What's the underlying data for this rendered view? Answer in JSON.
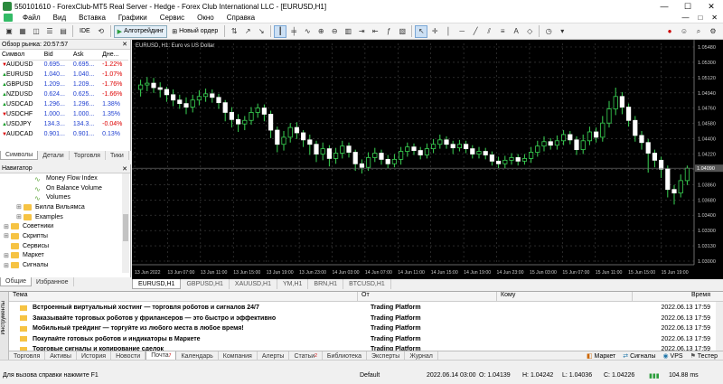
{
  "window": {
    "title": "550101610 - ForexClub-MT5 Real Server - Hedge - Forex Club International LLC - [EURUSD,H1]"
  },
  "menu": {
    "items": [
      "Файл",
      "Вид",
      "Вставка",
      "Графики",
      "Сервис",
      "Окно",
      "Справка"
    ],
    "right": [
      "—",
      "□",
      "✕"
    ]
  },
  "toolbar": {
    "algo": "Алготрейдинг",
    "neworder": "Новый ордер",
    "ide": "IDE"
  },
  "market_watch": {
    "header": "Обзор рынка: 20:57:57",
    "columns": [
      "Символ",
      "Bid",
      "Ask",
      "Дне..."
    ],
    "rows": [
      {
        "sym": "AUDUSD",
        "bid": "0.695...",
        "ask": "0.695...",
        "chg": "-1.22%",
        "dir": "dn"
      },
      {
        "sym": "EURUSD",
        "bid": "1.040...",
        "ask": "1.040...",
        "chg": "-1.07%",
        "dir": "up"
      },
      {
        "sym": "GBPUSD",
        "bid": "1.209...",
        "ask": "1.209...",
        "chg": "-1.76%",
        "dir": "up"
      },
      {
        "sym": "NZDUSD",
        "bid": "0.624...",
        "ask": "0.625...",
        "chg": "-1.66%",
        "dir": "up"
      },
      {
        "sym": "USDCAD",
        "bid": "1.296...",
        "ask": "1.296...",
        "chg": "1.38%",
        "dir": "up"
      },
      {
        "sym": "USDCHF",
        "bid": "1.000...",
        "ask": "1.000...",
        "chg": "1.35%",
        "dir": "dn"
      },
      {
        "sym": "USDJPY",
        "bid": "134.3...",
        "ask": "134.3...",
        "chg": "-0.04%",
        "dir": "up"
      },
      {
        "sym": "AUDCAD",
        "bid": "0.901...",
        "ask": "0.901...",
        "chg": "0.13%",
        "dir": "dn"
      }
    ],
    "tabs": [
      "Символы",
      "Детали",
      "Торговля",
      "Тики"
    ]
  },
  "navigator": {
    "header": "Навигатор",
    "items": [
      {
        "label": "Money Flow Index",
        "kind": "ind",
        "indent": 38
      },
      {
        "label": "On Balance Volume",
        "kind": "ind",
        "indent": 38
      },
      {
        "label": "Volumes",
        "kind": "ind",
        "indent": 38
      },
      {
        "label": "Билла Вильямса",
        "kind": "fold",
        "indent": 18,
        "pm": "⊞"
      },
      {
        "label": "Examples",
        "kind": "fold",
        "indent": 18,
        "pm": "⊞"
      },
      {
        "label": "Советники",
        "kind": "fold",
        "indent": 4,
        "pm": "⊞"
      },
      {
        "label": "Скрипты",
        "kind": "fold",
        "indent": 4,
        "pm": "⊞"
      },
      {
        "label": "Сервисы",
        "kind": "fold",
        "indent": 4,
        "pm": ""
      },
      {
        "label": "Маркет",
        "kind": "fold",
        "indent": 4,
        "pm": "⊞"
      },
      {
        "label": "Сигналы",
        "kind": "fold",
        "indent": 4,
        "pm": "⊞"
      }
    ],
    "tabs": [
      "Общие",
      "Избранное"
    ]
  },
  "chart": {
    "label": "EURUSD, H1:  Euro vs US Dollar",
    "tabs": [
      "EURUSD,H1",
      "GBPUSD,H1",
      "XAUUSD,H1",
      "YM,H1",
      "BRN,H1",
      "BTCUSD,H1"
    ]
  },
  "chart_data": {
    "type": "candlestick",
    "ylim": [
      1.03,
      1.055
    ],
    "y_ticks": [
      "1.05480",
      "1.05300",
      "1.05120",
      "1.04940",
      "1.04760",
      "1.04580",
      "1.04400",
      "1.04220",
      "1.04040",
      "1.03860",
      "1.03680",
      "1.03400",
      "1.03300",
      "1.03130",
      "1.03000"
    ],
    "x_ticks": [
      "13 Jun 2022",
      "13 Jun 07:00",
      "13 Jun 11:00",
      "13 Jun 15:00",
      "13 Jun 19:00",
      "13 Jun 23:00",
      "14 Jun 03:00",
      "14 Jun 07:00",
      "14 Jun 11:00",
      "14 Jun 15:00",
      "14 Jun 19:00",
      "14 Jun 23:00",
      "15 Jun 03:00",
      "15 Jun 07:00",
      "15 Jun 11:00",
      "15 Jun 15:00",
      "15 Jun 19:00"
    ],
    "current_price": "1.04090",
    "candles": [
      [
        1.0498,
        1.0503,
        1.049,
        1.0509
      ],
      [
        1.0503,
        1.0505,
        1.0496,
        1.0512
      ],
      [
        1.0505,
        1.05,
        1.0494,
        1.0511
      ],
      [
        1.05,
        1.0498,
        1.0489,
        1.0506
      ],
      [
        1.0498,
        1.0492,
        1.0484,
        1.0501
      ],
      [
        1.0492,
        1.0486,
        1.0479,
        1.0498
      ],
      [
        1.0486,
        1.0482,
        1.0476,
        1.0492
      ],
      [
        1.0482,
        1.0478,
        1.047,
        1.0489
      ],
      [
        1.0478,
        1.0486,
        1.0472,
        1.0492
      ],
      [
        1.0486,
        1.049,
        1.048,
        1.0497
      ],
      [
        1.049,
        1.0493,
        1.0484,
        1.0499
      ],
      [
        1.0493,
        1.0489,
        1.0483,
        1.0498
      ],
      [
        1.0489,
        1.0483,
        1.0476,
        1.0493
      ],
      [
        1.0483,
        1.0472,
        1.0462,
        1.0486
      ],
      [
        1.0472,
        1.0464,
        1.0455,
        1.0478
      ],
      [
        1.0464,
        1.0459,
        1.045,
        1.047
      ],
      [
        1.0459,
        1.0463,
        1.0452,
        1.0468
      ],
      [
        1.0463,
        1.0472,
        1.0458,
        1.0478
      ],
      [
        1.0472,
        1.0477,
        1.0466,
        1.0482
      ],
      [
        1.0477,
        1.047,
        1.0462,
        1.0481
      ],
      [
        1.047,
        1.0452,
        1.0443,
        1.0474
      ],
      [
        1.0452,
        1.0436,
        1.0427,
        1.0456
      ],
      [
        1.0436,
        1.0444,
        1.0429,
        1.0451
      ],
      [
        1.0444,
        1.0455,
        1.0438,
        1.046
      ],
      [
        1.0455,
        1.0449,
        1.0442,
        1.0461
      ],
      [
        1.0449,
        1.0441,
        1.0433,
        1.0452
      ],
      [
        1.0441,
        1.0436,
        1.0424,
        1.0447
      ],
      [
        1.0436,
        1.0425,
        1.0416,
        1.044
      ],
      [
        1.0425,
        1.0431,
        1.0418,
        1.0438
      ],
      [
        1.0431,
        1.042,
        1.0411,
        1.0435
      ],
      [
        1.042,
        1.0426,
        1.0414,
        1.0432
      ],
      [
        1.0426,
        1.0434,
        1.042,
        1.044
      ],
      [
        1.0434,
        1.0427,
        1.0421,
        1.0438
      ],
      [
        1.0427,
        1.0414,
        1.0406,
        1.043
      ],
      [
        1.0414,
        1.041,
        1.0403,
        1.0419
      ],
      [
        1.041,
        1.0421,
        1.0406,
        1.0427
      ],
      [
        1.0421,
        1.0426,
        1.0416,
        1.0432
      ],
      [
        1.0426,
        1.0419,
        1.0413,
        1.043
      ],
      [
        1.0419,
        1.0414,
        1.0409,
        1.0424
      ],
      [
        1.0414,
        1.0419,
        1.041,
        1.0425
      ],
      [
        1.0419,
        1.0428,
        1.0413,
        1.0433
      ],
      [
        1.0428,
        1.0433,
        1.0422,
        1.0438
      ],
      [
        1.0433,
        1.0429,
        1.0424,
        1.0437
      ],
      [
        1.0429,
        1.0424,
        1.0419,
        1.0433
      ],
      [
        1.0424,
        1.0431,
        1.042,
        1.0437
      ],
      [
        1.0431,
        1.0436,
        1.0426,
        1.0442
      ],
      [
        1.0436,
        1.0441,
        1.0431,
        1.0447
      ],
      [
        1.0441,
        1.0436,
        1.0431,
        1.0445
      ],
      [
        1.0436,
        1.0432,
        1.0425,
        1.044
      ],
      [
        1.0432,
        1.0436,
        1.0428,
        1.0441
      ],
      [
        1.0436,
        1.0431,
        1.0426,
        1.044
      ],
      [
        1.0431,
        1.0425,
        1.042,
        1.0435
      ],
      [
        1.0425,
        1.0428,
        1.042,
        1.0433
      ],
      [
        1.0428,
        1.0424,
        1.0419,
        1.0432
      ],
      [
        1.0424,
        1.0417,
        1.0412,
        1.0428
      ],
      [
        1.0417,
        1.0414,
        1.0409,
        1.0422
      ],
      [
        1.0414,
        1.0418,
        1.0409,
        1.0423
      ],
      [
        1.0418,
        1.0421,
        1.0413,
        1.0426
      ],
      [
        1.0421,
        1.0417,
        1.0412,
        1.0425
      ],
      [
        1.0417,
        1.042,
        1.0413,
        1.0425
      ],
      [
        1.042,
        1.0427,
        1.0415,
        1.0433
      ],
      [
        1.0427,
        1.0434,
        1.0422,
        1.044
      ],
      [
        1.0434,
        1.0439,
        1.0428,
        1.0445
      ],
      [
        1.0439,
        1.0435,
        1.043,
        1.0443
      ],
      [
        1.0435,
        1.044,
        1.043,
        1.0446
      ],
      [
        1.044,
        1.0447,
        1.0435,
        1.0452
      ],
      [
        1.0447,
        1.0441,
        1.0436,
        1.0451
      ],
      [
        1.0441,
        1.043,
        1.0424,
        1.0445
      ],
      [
        1.043,
        1.044,
        1.0425,
        1.0447
      ],
      [
        1.044,
        1.045,
        1.0435,
        1.0456
      ],
      [
        1.045,
        1.0444,
        1.0438,
        1.0455
      ],
      [
        1.0444,
        1.046,
        1.0439,
        1.0468
      ],
      [
        1.046,
        1.0476,
        1.0455,
        1.0485
      ],
      [
        1.0476,
        1.049,
        1.0469,
        1.05
      ],
      [
        1.049,
        1.0478,
        1.047,
        1.0495
      ],
      [
        1.0478,
        1.0463,
        1.0456,
        1.0482
      ],
      [
        1.0463,
        1.0446,
        1.0439,
        1.0468
      ],
      [
        1.0446,
        1.0438,
        1.043,
        1.0451
      ],
      [
        1.0438,
        1.0426,
        1.0404,
        1.0442
      ],
      [
        1.0426,
        1.0418,
        1.041,
        1.043
      ],
      [
        1.0418,
        1.0408,
        1.0398,
        1.0422
      ],
      [
        1.0408,
        1.0385,
        1.0376,
        1.0412
      ],
      [
        1.0385,
        1.0381,
        1.0368,
        1.039
      ],
      [
        1.0381,
        1.0395,
        1.0376,
        1.0402
      ],
      [
        1.0395,
        1.0409,
        1.039,
        1.0412
      ]
    ]
  },
  "terminal": {
    "side_label": "Инструменты",
    "columns": [
      "Тема",
      "От",
      "Кому",
      "Время"
    ],
    "rows": [
      {
        "subject": "Встроенный виртуальный хостинг — торговля роботов и сигналов 24/7",
        "from": "Trading Platform",
        "time": "2022.06.13 17:59"
      },
      {
        "subject": "Заказывайте торговых роботов у фрилансеров — это быстро и эффективно",
        "from": "Trading Platform",
        "time": "2022.06.13 17:59"
      },
      {
        "subject": "Мобильный трейдинг — торгуйте из любого места в любое время!",
        "from": "Trading Platform",
        "time": "2022.06.13 17:59"
      },
      {
        "subject": "Покупайте готовых роботов и индикаторы в Маркете",
        "from": "Trading Platform",
        "time": "2022.06.13 17:59"
      },
      {
        "subject": "Торговые сигналы и копирование сделок",
        "from": "Trading Platform",
        "time": "2022.06.13 17:59"
      }
    ],
    "tabs": [
      "Торговля",
      "Активы",
      "История",
      "Новости",
      "Почта",
      "Календарь",
      "Компания",
      "Алерты",
      "Статьи",
      "Библиотека",
      "Эксперты",
      "Журнал"
    ],
    "mail_badge": "7",
    "articles_badge": "2",
    "right": [
      "Маркет",
      "Сигналы",
      "VPS",
      "Тестер"
    ]
  },
  "status": {
    "help": "Для вызова справки нажмите F1",
    "profile": "Default",
    "datetime": "2022.06.14 03:00",
    "open": "O: 1.04139",
    "high": "H: 1.04242",
    "low": "L: 1.04036",
    "close": "C: 1.04226",
    "ping": "104.88 ms"
  }
}
